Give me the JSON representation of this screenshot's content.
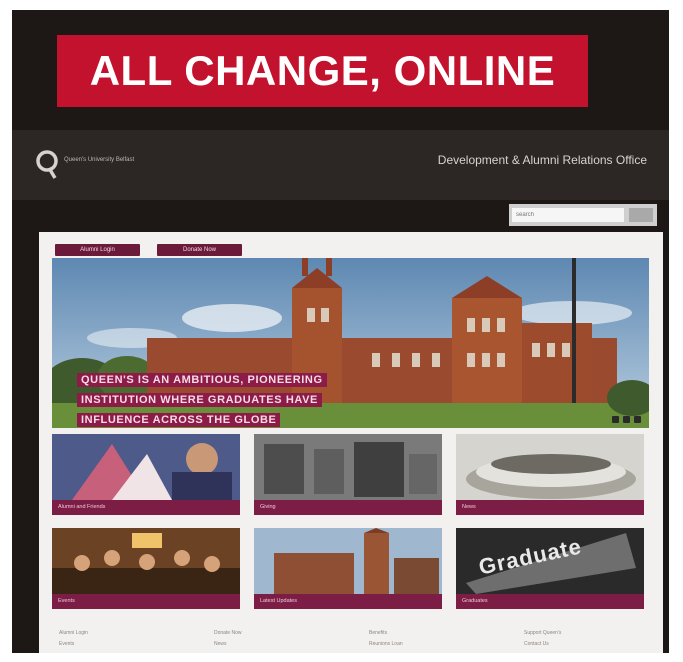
{
  "headline": "ALL CHANGE, ONLINE",
  "header": {
    "university": "Queen's University Belfast",
    "office": "Development & Alumni Relations Office"
  },
  "search": {
    "placeholder": "search"
  },
  "nav_tabs": [
    "Alumni Login",
    "Donate Now"
  ],
  "hero": {
    "caption_lines": [
      "QUEEN'S IS AN AMBITIOUS, PIONEERING",
      "INSTITUTION WHERE GRADUATES HAVE",
      "INFLUENCE ACROSS THE GLOBE"
    ]
  },
  "tiles": [
    "Alumni and Friends",
    "Giving",
    "News",
    "Events",
    "Latest Updates",
    "Graduates"
  ],
  "graduate_sign_text": "Graduate",
  "footer_links": [
    "Alumni Login",
    "Events",
    "Donate Now",
    "News",
    "Benefits",
    "Reunions Loan",
    "Support Queen's",
    "Contact Us"
  ],
  "colors": {
    "headline_bg": "#c3122d",
    "frame_bg": "#1d1715",
    "maroon": "#7c1d45"
  }
}
